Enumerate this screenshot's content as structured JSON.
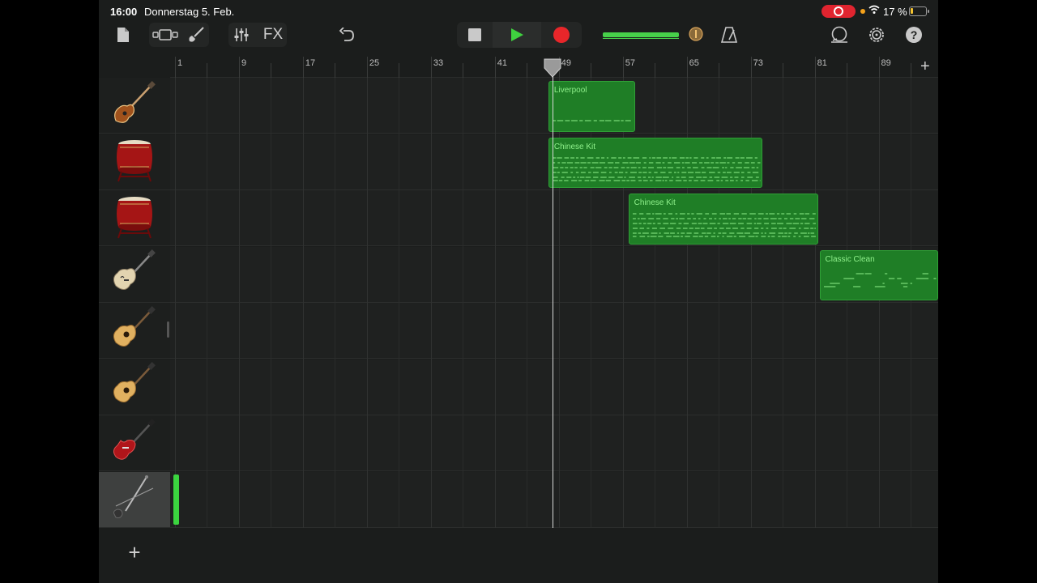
{
  "status_bar": {
    "time": "16:00",
    "date": "Donnerstag 5. Feb.",
    "battery_percent": "17 %",
    "battery_level": 0.17,
    "record_indicator_color": "#e0242f"
  },
  "toolbar": {
    "fx_label": "FX",
    "icons": [
      "document-icon",
      "view-toggle-icon",
      "instrument-browser-icon",
      "mixer-icon",
      "undo-icon",
      "stop-icon",
      "play-icon",
      "record-icon",
      "volume-knob-icon",
      "metronome-icon",
      "loop-browser-icon",
      "settings-icon",
      "help-icon"
    ],
    "accent_color": "#47d14a",
    "record_color": "#e8262a",
    "play_color": "#3fd23f"
  },
  "ruler": {
    "bars": [
      "1",
      "9",
      "17",
      "25",
      "33",
      "41",
      "49",
      "57",
      "65",
      "73",
      "81",
      "89"
    ]
  },
  "tracks": [
    {
      "instrument": "bass-guitar",
      "icon": "bass-guitar-icon"
    },
    {
      "instrument": "chinese-drum",
      "icon": "chinese-drum-icon"
    },
    {
      "instrument": "chinese-drum",
      "icon": "chinese-drum-icon"
    },
    {
      "instrument": "hollow-body-guitar",
      "icon": "hollow-body-guitar-icon"
    },
    {
      "instrument": "acoustic-guitar",
      "icon": "acoustic-guitar-icon"
    },
    {
      "instrument": "acoustic-guitar",
      "icon": "acoustic-guitar-icon"
    },
    {
      "instrument": "electric-guitar",
      "icon": "electric-guitar-icon"
    },
    {
      "instrument": "erhu",
      "icon": "erhu-icon",
      "selected": true
    }
  ],
  "regions": [
    {
      "title": "Liverpool",
      "track": 0,
      "start_bar": 47.7,
      "end_bar": 58.5
    },
    {
      "title": "Chinese Kit",
      "track": 1,
      "start_bar": 47.7,
      "end_bar": 74.5
    },
    {
      "title": "Chinese Kit",
      "track": 2,
      "start_bar": 57.7,
      "end_bar": 81.4
    },
    {
      "title": "Classic Clean",
      "track": 3,
      "start_bar": 81.6,
      "end_bar": 97.5
    }
  ],
  "playhead_bar": 48.2,
  "region_color": "#1f7e26",
  "region_text_color": "#8ff08b"
}
